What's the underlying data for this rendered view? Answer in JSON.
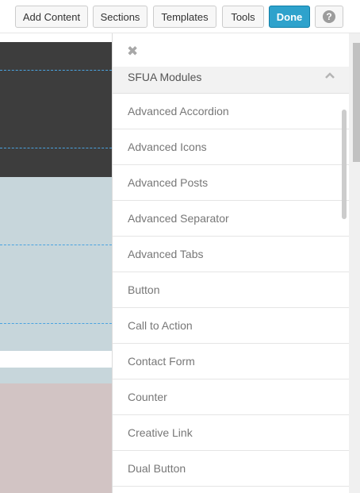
{
  "toolbar": {
    "add_content": "Add Content",
    "sections": "Sections",
    "templates": "Templates",
    "tools": "Tools",
    "done": "Done",
    "help_icon": "?"
  },
  "panel": {
    "close_icon": "✖",
    "section_title": "SFUA Modules",
    "modules": [
      "Advanced Accordion",
      "Advanced Icons",
      "Advanced Posts",
      "Advanced Separator",
      "Advanced Tabs",
      "Button",
      "Call to Action",
      "Contact Form",
      "Counter",
      "Creative Link",
      "Dual Button"
    ]
  },
  "colors": {
    "primary": "#2ea2cc",
    "dark_band": "#3d3d3d",
    "blue_band": "#c7d6db",
    "pink_band": "#d2c4c4",
    "guide_line": "#4aa3e0"
  },
  "icons": {
    "close": "close-icon",
    "help": "help-icon",
    "collapse": "chevron-up-icon"
  }
}
